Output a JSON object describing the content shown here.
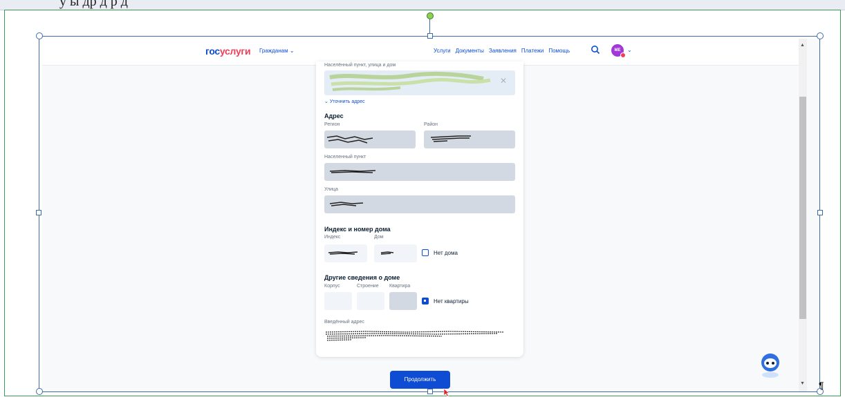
{
  "document": {
    "top_text": "у       ы         др                  д                                              р д"
  },
  "navbar": {
    "logo_part1": "гос",
    "logo_part2": "услуги",
    "citizens_label": "Гражданам",
    "links": [
      "Услуги",
      "Документы",
      "Заявления",
      "Платежи",
      "Помощь"
    ],
    "avatar_initials": "МЕ"
  },
  "form": {
    "settlement_street_label": "Населённый пункт, улица и дом",
    "clarify_link": "Уточнить адрес",
    "address_heading": "Адрес",
    "region_label": "Регион",
    "district_label": "Район",
    "settlement_label": "Населенный пункт",
    "street_label": "Улица",
    "index_house_heading": "Индекс и номер дома",
    "index_label": "Индекс",
    "house_label": "Дом",
    "no_house_label": "Нет дома",
    "no_house_checked": false,
    "other_info_heading": "Другие сведения о доме",
    "building_label": "Корпус",
    "structure_label": "Строение",
    "apartment_label": "Квартира",
    "no_apartment_label": "Нет квартиры",
    "no_apartment_checked": true,
    "entered_address_label": "Введённый адрес"
  },
  "continue_button": "Продолжить",
  "colors": {
    "brand_blue": "#0d4cd3",
    "brand_red": "#ee3f58",
    "field_bg": "#e4ecf6",
    "readonly_bg": "#d3d9e2"
  },
  "icons": [
    "search-icon",
    "chevron-down-icon",
    "close-icon",
    "checkbox-icon",
    "assistant-robot-icon",
    "cursor-icon"
  ]
}
